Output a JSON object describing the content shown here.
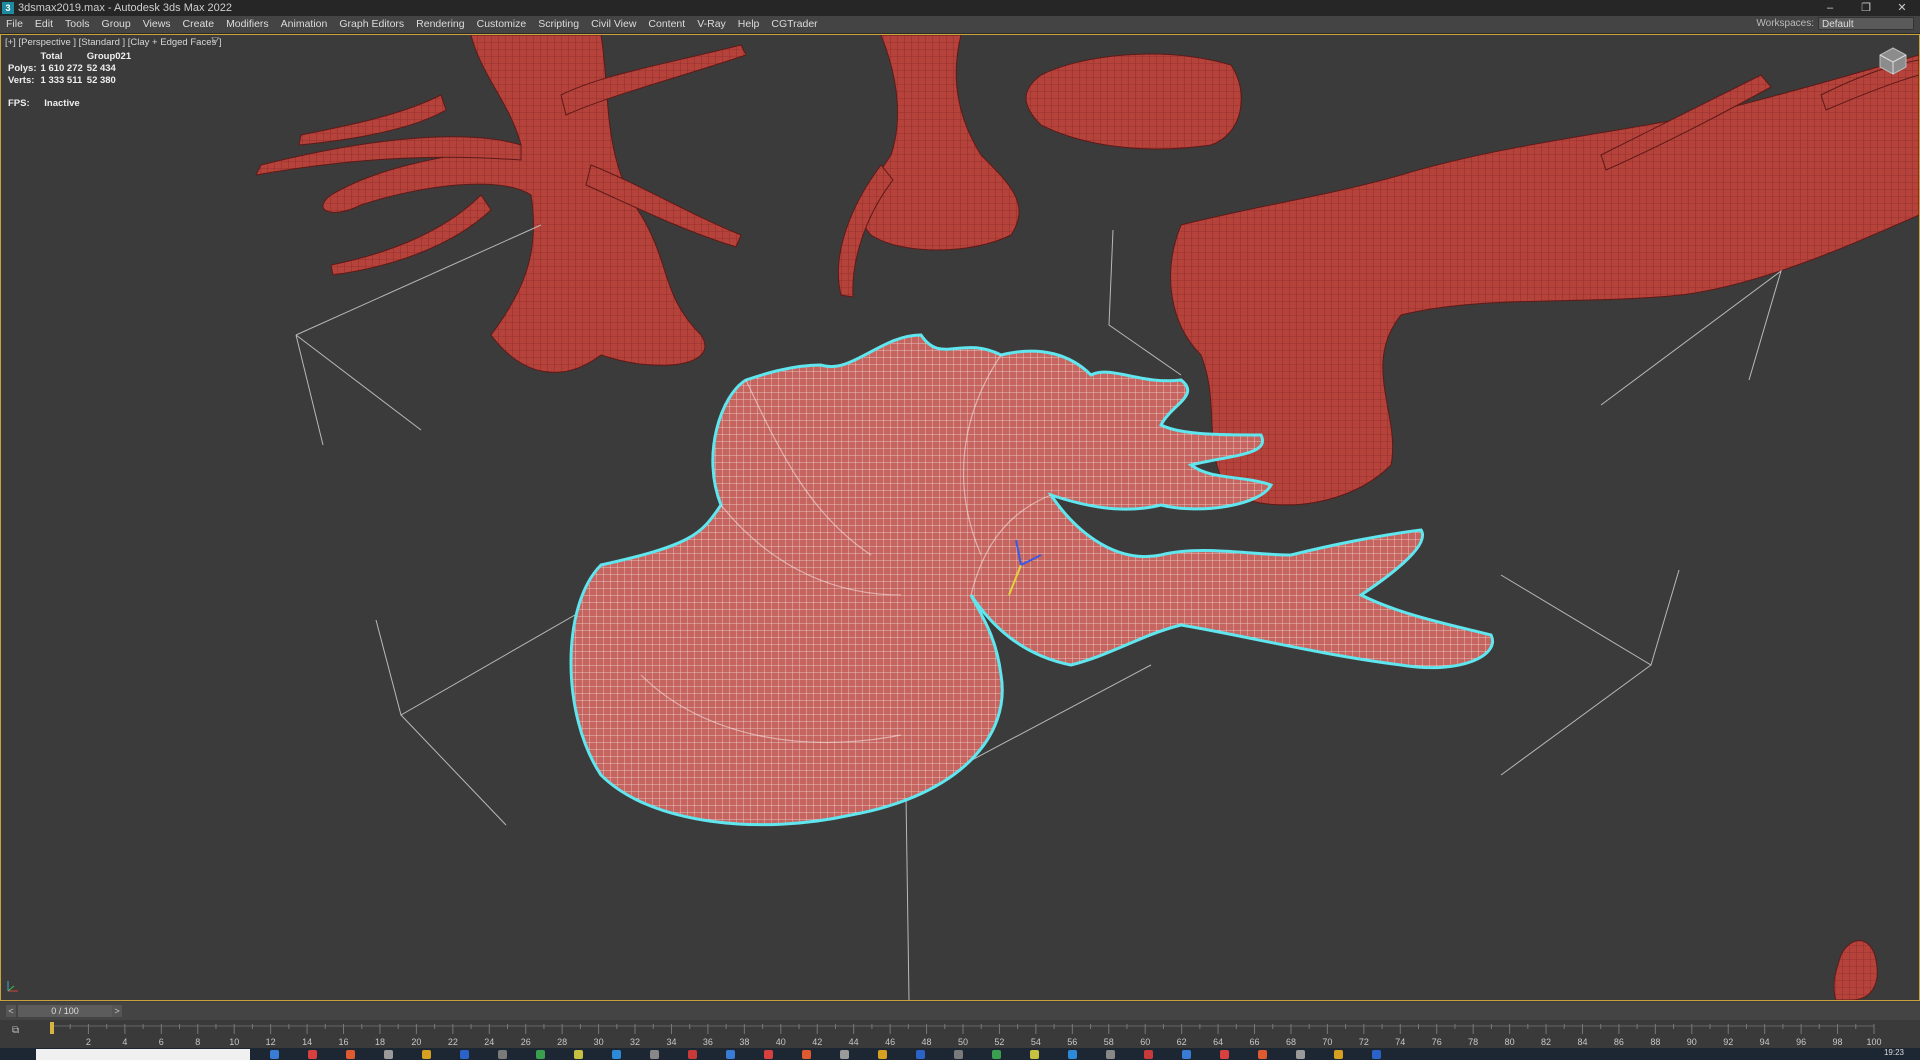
{
  "window": {
    "title": "3dsmax2019.max - Autodesk 3ds Max 2022",
    "app_icon_glyph": "3",
    "controls": {
      "minimize": "–",
      "restore": "❐",
      "close": "✕"
    }
  },
  "menu": {
    "items": [
      "File",
      "Edit",
      "Tools",
      "Group",
      "Views",
      "Create",
      "Modifiers",
      "Animation",
      "Graph Editors",
      "Rendering",
      "Customize",
      "Scripting",
      "Civil View",
      "Content",
      "V-Ray",
      "Help",
      "CGTrader"
    ],
    "workspaces_label": "Workspaces:",
    "workspaces_value": "Default"
  },
  "viewport": {
    "label": "[+] [Perspective ] [Standard ] [Clay + Edged Faces ]",
    "stats": {
      "headers": [
        "",
        "Total",
        "Group021"
      ],
      "rows": [
        {
          "label": "Polys:",
          "total": "1 610 272",
          "selected": "52 434"
        },
        {
          "label": "Verts:",
          "total": "1 333 511",
          "selected": "52 380"
        }
      ]
    },
    "fps_label": "FPS:",
    "fps_value": "Inactive",
    "colors": {
      "mesh": "#b5423b",
      "selected_mesh": "#c6655f",
      "selection_outline": "#5fe6ee",
      "background": "#3b3b3b"
    }
  },
  "timeslider": {
    "prev": "<",
    "frame": "0 / 100",
    "next": ">"
  },
  "trackbar": {
    "ticks": [
      2,
      4,
      6,
      8,
      10,
      12,
      14,
      16,
      18,
      20,
      22,
      24,
      26,
      28,
      30,
      32,
      34,
      36,
      38,
      40,
      42,
      44,
      46,
      48,
      50,
      52,
      54,
      56,
      58,
      60,
      62,
      64,
      66,
      68,
      70,
      72,
      74,
      76,
      78,
      80,
      82,
      84,
      86,
      88,
      90,
      92,
      94,
      96,
      98,
      100
    ],
    "max": 100
  },
  "taskbar": {
    "clock": "19:23"
  }
}
